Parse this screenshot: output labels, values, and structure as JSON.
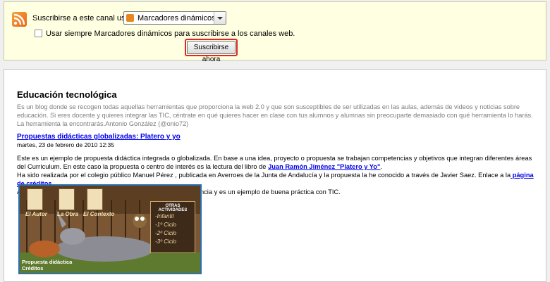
{
  "subscribe": {
    "label": "Suscribirse a este canal usando",
    "selected_option": "Marcadores dinámicos",
    "checkbox_label": "Usar siempre Marcadores dinámicos para suscribirse a los canales web.",
    "checkbox_checked": false,
    "button_label": "Suscribirse ahora"
  },
  "feed": {
    "title": "Educación tecnológica",
    "description": "Es un blog donde se recogen todas aquellas herramientas que proporciona la web 2.0 y que son susceptibles de ser utilizadas en las aulas, además de videos y noticias sobre educación. Si eres docente y quieres integrar las TIC, céntrate en qué quieres hacer en clase con tus alumnos y alumnas sin preocuparte demasiado con qué herramienta lo harás. La herramienta la encontrarás.Antonio González (@onio72)"
  },
  "post": {
    "title": "Propuestas didácticas globalizadas: Platero y yo",
    "date": "martes, 23 de febrero de 2010 12:35",
    "p1": "Este es un ejemplo de propuesta didáctica integrada o globalizada. En base a una idea, proyecto o propuesta se trabajan competencias y objetivos que integran diferentes áreas del Currículum. En este caso la propuesta o centro de interés es la lectura del libro de ",
    "p1_link": "Juan Ramón Jiménez \"Platero y Yo\"",
    "p1_end": ".",
    "p2": "Ha sido realizada por el colegio público Manuel Pérez , publicada en Averroes de la Junta de Andalucía y la propuesta la he conocido a través de Javier Saez. Enlace a la",
    "p2_link": " página de créditos",
    "p2_end": ".",
    "p3": "Aunque es una propuesta de hace varios años tiene plena vigencia y es un ejemplo de buena práctica con TIC.",
    "image": {
      "card1": "El Autor",
      "card2": "La Obra",
      "card3": "El Contexto",
      "activities_title": "OTRAS ACTIVIDADES",
      "activities": [
        "-Infantil",
        "-1º Ciclo",
        "-2º Ciclo",
        "-3º Ciclo"
      ],
      "caption1": "Propuesta didáctica",
      "caption2": "Créditos"
    }
  }
}
